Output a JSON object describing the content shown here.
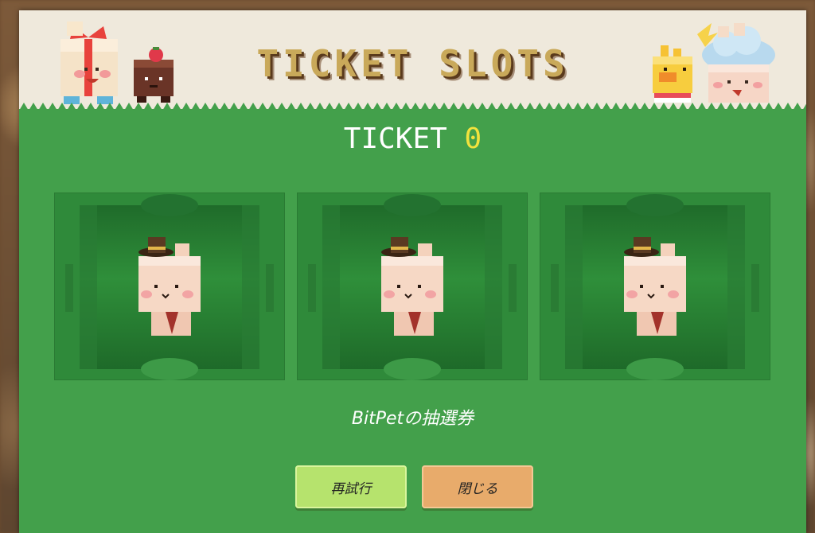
{
  "modal": {
    "title": "TICKET SLOTS",
    "ticket_label": "TICKET",
    "ticket_count": "0",
    "caption": "BitPetの抽選券"
  },
  "slots": [
    {
      "pet": "bunny-top-hat-icon"
    },
    {
      "pet": "bunny-top-hat-icon"
    },
    {
      "pet": "bunny-top-hat-icon"
    }
  ],
  "buttons": {
    "retry_label": "再試行",
    "close_label": "閉じる"
  },
  "colors": {
    "panel_green": "#43a04b",
    "slot_green": "#2f8a3a",
    "header_cream": "#efe9dc",
    "count_yellow": "#f2e23d",
    "retry_button": "#b6e36d",
    "close_button": "#e8ab6b"
  }
}
